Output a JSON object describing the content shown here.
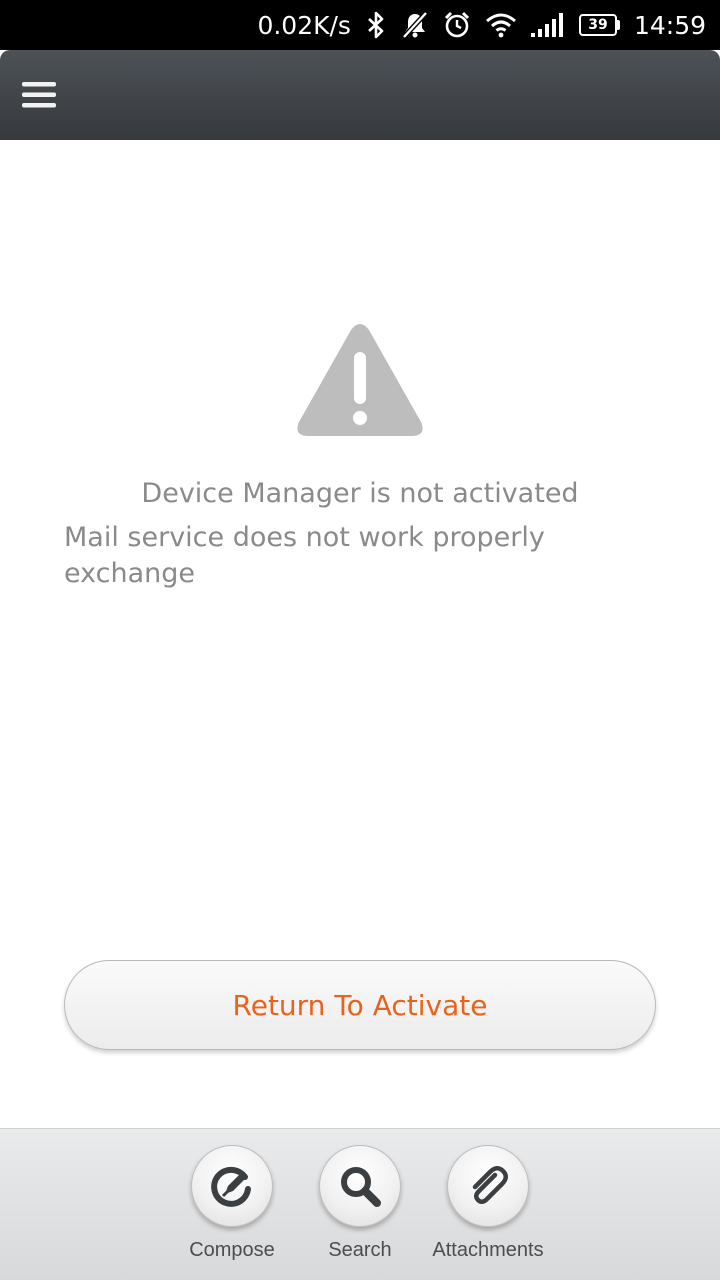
{
  "status_bar": {
    "network_speed": "0.02K/s",
    "battery_level": "39",
    "time": "14:59",
    "icons": [
      "bluetooth-icon",
      "notifications-muted-icon",
      "alarm-icon",
      "wifi-icon",
      "signal-icon",
      "battery-icon"
    ]
  },
  "header": {
    "menu_icon": "hamburger-menu-icon"
  },
  "main": {
    "icon": "warning-triangle-icon",
    "title": "Device Manager is not activated",
    "description_line1": "Mail service does not work properly",
    "description_line2": "exchange",
    "action_label": "Return To Activate"
  },
  "toolbar": {
    "compose_label": "Compose",
    "search_label": "Search",
    "attachments_label": "Attachments"
  },
  "colors": {
    "accent": "#e8631c",
    "header": "#3d4145",
    "muted_text": "#8a8a8a",
    "icon_gray": "#bdbdbd"
  }
}
